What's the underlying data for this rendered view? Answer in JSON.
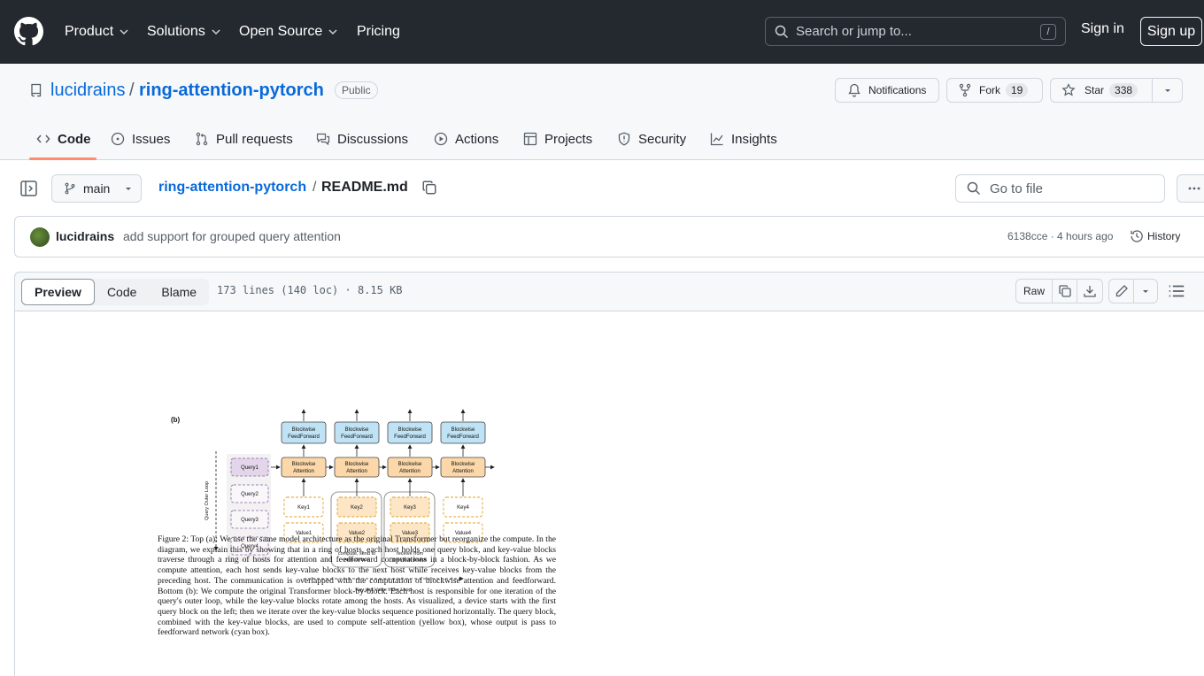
{
  "header": {
    "nav": [
      {
        "label": "Product",
        "dropdown": true
      },
      {
        "label": "Solutions",
        "dropdown": true
      },
      {
        "label": "Open Source",
        "dropdown": true
      },
      {
        "label": "Pricing",
        "dropdown": false
      }
    ],
    "search_placeholder": "Search or jump to...",
    "search_key": "/",
    "sign_in": "Sign in",
    "sign_up": "Sign up"
  },
  "repo": {
    "owner": "lucidrains",
    "separator": "/",
    "name": "ring-attention-pytorch",
    "visibility": "Public",
    "notifications_label": "Notifications",
    "fork_label": "Fork",
    "fork_count": "19",
    "star_label": "Star",
    "star_count": "338"
  },
  "tabs": [
    {
      "label": "Code",
      "active": true
    },
    {
      "label": "Issues"
    },
    {
      "label": "Pull requests"
    },
    {
      "label": "Discussions"
    },
    {
      "label": "Actions"
    },
    {
      "label": "Projects"
    },
    {
      "label": "Security"
    },
    {
      "label": "Insights"
    }
  ],
  "file_nav": {
    "branch": "main",
    "crumb_repo": "ring-attention-pytorch",
    "crumb_sep": "/",
    "crumb_file": "README.md",
    "goto_placeholder": "Go to file"
  },
  "commit": {
    "author": "lucidrains",
    "message": "add support for grouped query attention",
    "sha_time": "6138cce · 4 hours ago",
    "history": "History"
  },
  "file_toolbar": {
    "modes": [
      "Preview",
      "Code",
      "Blame"
    ],
    "meta": "173 lines (140 loc) · 8.15 KB",
    "raw": "Raw"
  },
  "figure": {
    "panel_label": "(b)",
    "outer_loop_label": "Query Outer Loop",
    "inner_loop_label": "Key and Value Inner Loop",
    "ffn_label_1": "Blockwise",
    "ffn_label_2": "FeedForward",
    "attn_label_1": "Blockwise",
    "attn_label_2": "Attention",
    "queries": [
      "Query1",
      "Query2",
      "Query3",
      "Query4"
    ],
    "keys": [
      "Key1",
      "Key2",
      "Key3",
      "Key4"
    ],
    "values": [
      "Value1",
      "Value2",
      "Value3",
      "Value4"
    ],
    "send_note_1": "compute, send to",
    "send_note_2": "next device",
    "recv_note_1": "receive from",
    "recv_note_2": "previous device",
    "caption": "Figure 2: Top (a): We use the same model architecture as the original Transformer but reorganize the compute. In the diagram, we explain this by showing that in a ring of hosts, each host holds one query block, and key-value blocks traverse through a ring of hosts for attention and feedforward computations in a block-by-block fashion. As we compute attention, each host sends key-value blocks to the next host while receives key-value blocks from the preceding host. The communication is overlapped with the computation of blockwise attention and feedforward. Bottom (b): We compute the original Transformer block-by-block. Each host is responsible for one iteration of the query's outer loop, while the key-value blocks rotate among the hosts. As visualized, a device starts with the first query block on the left; then we iterate over the key-value blocks sequence positioned horizontally. The query block, combined with the key-value blocks, are used to compute self-attention (yellow box), whose output is pass to feedforward network (cyan box)."
  },
  "colors": {
    "header_bg": "#24292f",
    "link": "#0969da",
    "tab_underline": "#fd8c73",
    "ffn_fill": "#bfe3f4",
    "attn_fill": "#fbd7a9",
    "query_fill": "#e4d6ea",
    "kv_fill": "#fde6c6"
  }
}
